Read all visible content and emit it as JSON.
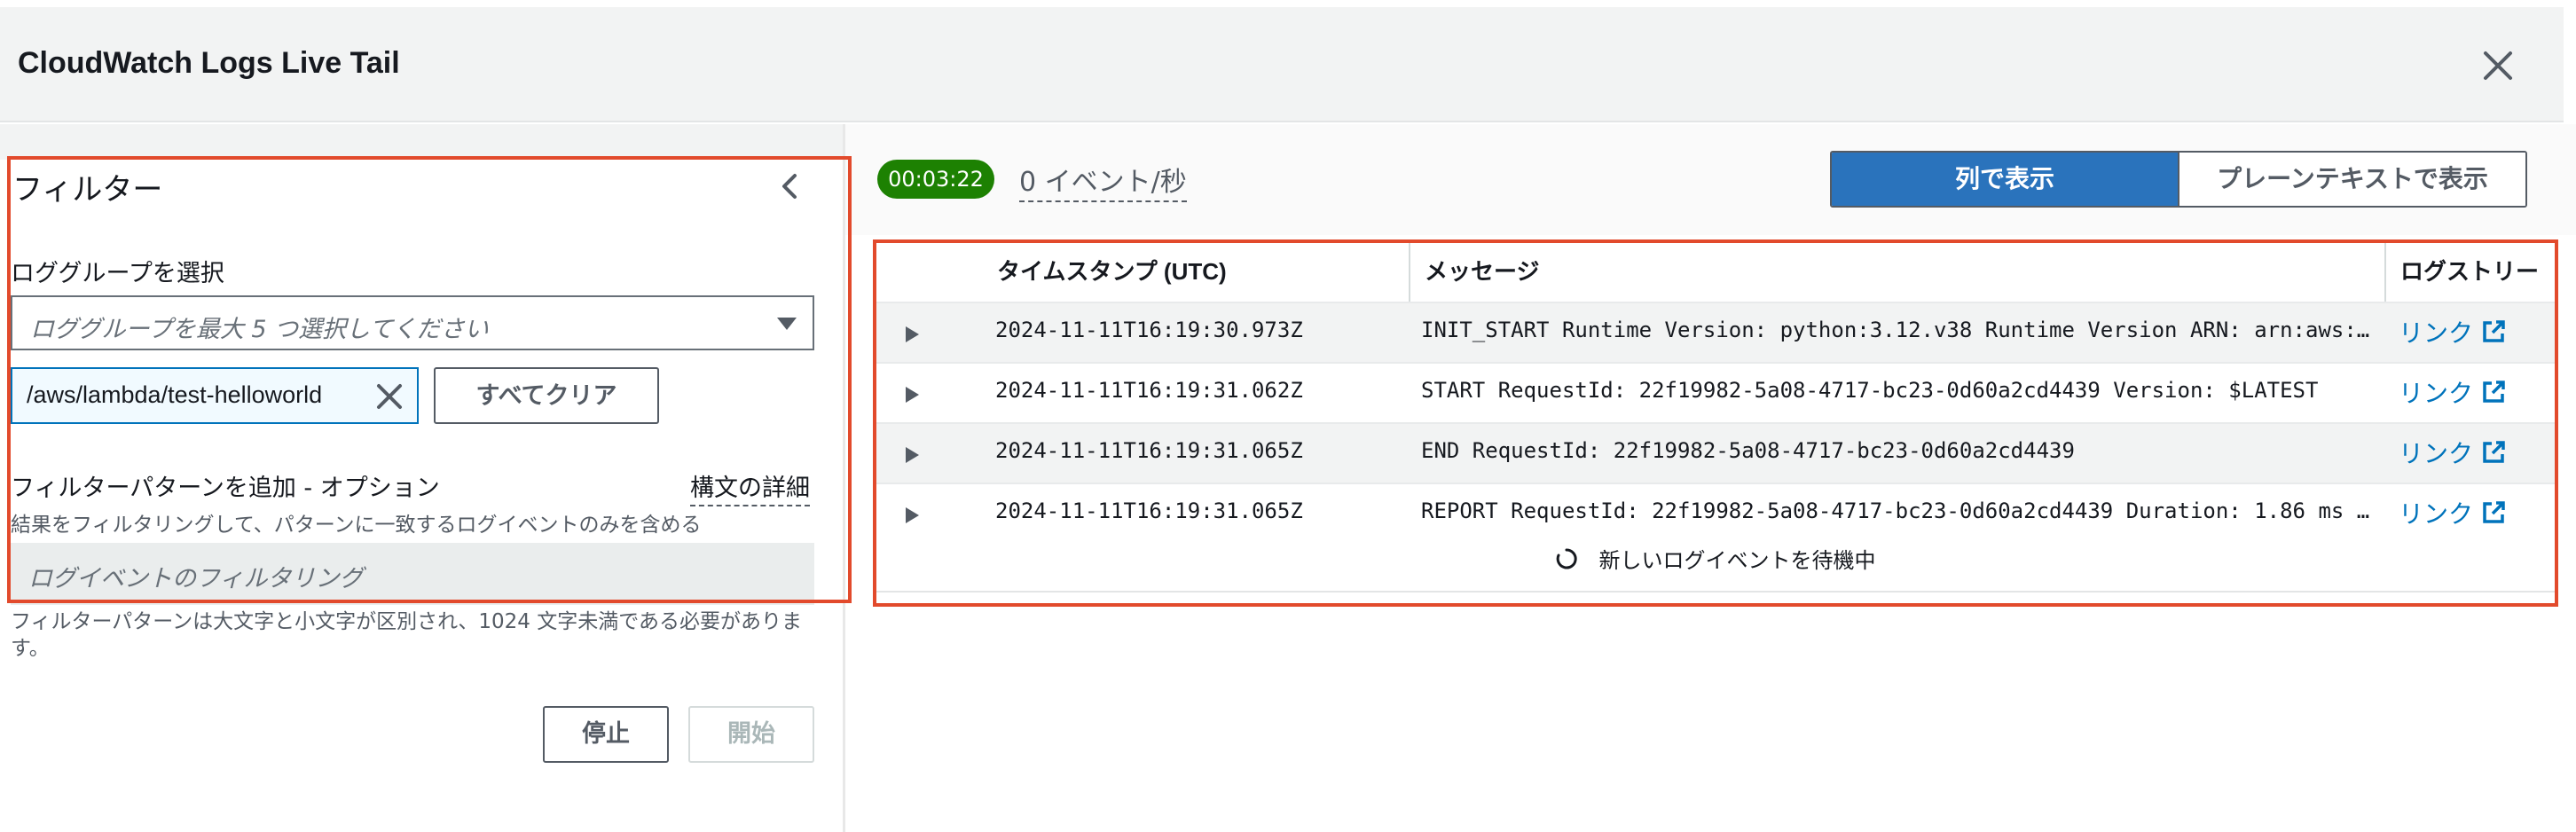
{
  "header": {
    "title": "CloudWatch Logs Live Tail"
  },
  "filter_panel": {
    "title": "フィルター",
    "log_group_label": "ロググループを選択",
    "log_group_placeholder": "ロググループを最大 5 つ選択してください",
    "selected_token": "/aws/lambda/test-helloworld",
    "clear_all_label": "すべてクリア",
    "pattern_label": "フィルターパターンを追加 - オプション",
    "syntax_link": "構文の詳細",
    "pattern_description": "結果をフィルタリングして、パターンに一致するログイベントのみを含める",
    "pattern_placeholder": "ログイベントのフィルタリング",
    "pattern_hint": "フィルターパターンは大文字と小文字が区別され、1024 文字未満である必要があります。",
    "stop_label": "停止",
    "start_label": "開始"
  },
  "toolbar": {
    "timer": "00:03:22",
    "rate": "0 イベント/秒",
    "view_columns": "列で表示",
    "view_plaintext": "プレーンテキストで表示"
  },
  "table": {
    "columns": [
      "タイムスタンプ (UTC)",
      "メッセージ",
      "ログストリーム"
    ],
    "rows": [
      {
        "timestamp": "2024-11-11T16:19:30.973Z",
        "message": "INIT_START Runtime Version: python:3.12.v38 Runtime Version ARN: arn:aws:...",
        "link": "リンク"
      },
      {
        "timestamp": "2024-11-11T16:19:31.062Z",
        "message": "START RequestId: 22f19982-5a08-4717-bc23-0d60a2cd4439 Version: $LATEST",
        "link": "リンク"
      },
      {
        "timestamp": "2024-11-11T16:19:31.065Z",
        "message": "END RequestId: 22f19982-5a08-4717-bc23-0d60a2cd4439",
        "link": "リンク"
      },
      {
        "timestamp": "2024-11-11T16:19:31.065Z",
        "message": "REPORT RequestId: 22f19982-5a08-4717-bc23-0d60a2cd4439 Duration: 1.86 ms ...",
        "link": "リンク"
      }
    ],
    "waiting_text": "新しいログイベントを待機中"
  },
  "colors": {
    "accent": "#2a73bc",
    "link": "#0073bb",
    "timer_bg": "#1d8102",
    "highlight": "#e24a2c"
  },
  "icons": [
    "close-icon",
    "chevron-left-icon",
    "caret-down-icon",
    "remove-token-icon",
    "play-expand-icon",
    "external-link-icon",
    "spinner-icon"
  ]
}
